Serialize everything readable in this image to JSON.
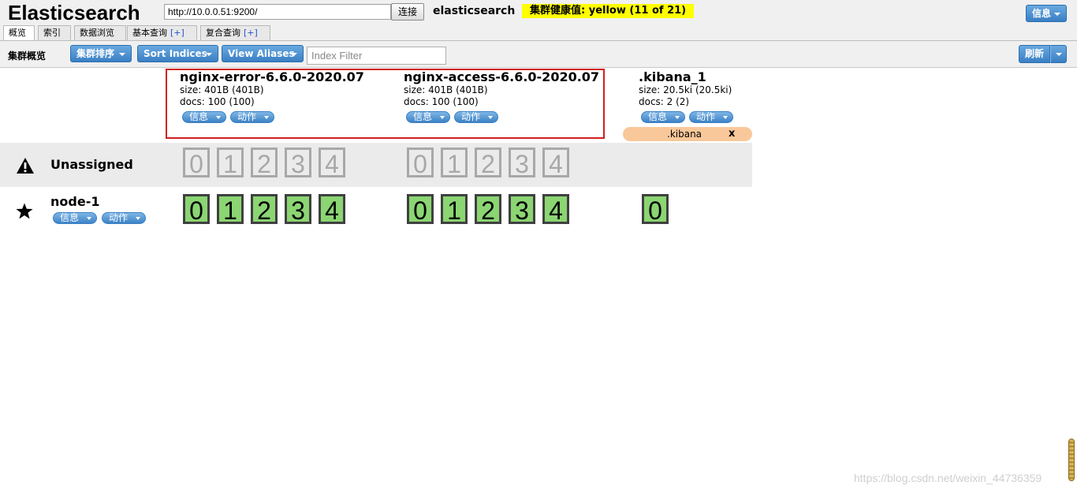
{
  "app": {
    "title": "Elasticsearch"
  },
  "connection": {
    "url": "http://10.0.0.51:9200/",
    "connect_label": "连接"
  },
  "cluster": {
    "name": "elasticsearch",
    "health": "集群健康值: yellow (11 of 21)",
    "health_color": "#ffff00"
  },
  "header": {
    "info_label": "信息"
  },
  "tabs": [
    {
      "label": "概览",
      "active": true
    },
    {
      "label": "索引"
    },
    {
      "label": "数据浏览"
    },
    {
      "label": "基本查询",
      "plus": "[+]"
    },
    {
      "label": "复合查询",
      "plus": "[+]"
    }
  ],
  "toolbar": {
    "title": "集群概览",
    "sort_cluster_label": "集群排序",
    "sort_indices_label": "Sort Indices",
    "view_aliases_label": "View Aliases",
    "filter_placeholder": "Index Filter",
    "refresh_label": "刷新"
  },
  "indices": [
    {
      "name": "nginx-error-6.6.0-2020.07",
      "size": "size: 401B (401B)",
      "docs": "docs: 100 (100)",
      "info_label": "信息",
      "action_label": "动作"
    },
    {
      "name": "nginx-access-6.6.0-2020.07",
      "size": "size: 401B (401B)",
      "docs": "docs: 100 (100)",
      "info_label": "信息",
      "action_label": "动作"
    },
    {
      "name": ".kibana_1",
      "size": "size: 20.5ki (20.5ki)",
      "docs": "docs: 2 (2)",
      "info_label": "信息",
      "action_label": "动作"
    }
  ],
  "alias": {
    "name": ".kibana",
    "close_label": "x",
    "color": "#f9c89a"
  },
  "rows": {
    "unassigned": {
      "label": "Unassigned",
      "icon": "warning-icon"
    },
    "node": {
      "label": "node-1",
      "icon": "star-icon",
      "info_label": "信息",
      "action_label": "动作"
    }
  },
  "shards": {
    "unassigned": {
      "error": [
        "0",
        "1",
        "2",
        "3",
        "4"
      ],
      "access": [
        "0",
        "1",
        "2",
        "3",
        "4"
      ]
    },
    "node": {
      "error": [
        "0",
        "1",
        "2",
        "3",
        "4"
      ],
      "access": [
        "0",
        "1",
        "2",
        "3",
        "4"
      ],
      "kibana": [
        "0"
      ]
    }
  },
  "colors": {
    "primary_button": "#3a7fc4",
    "started_shard": "#8bd572",
    "unassigned_shard": "#a8a8a8",
    "highlight_box": "#d02020"
  },
  "watermark": "https://blog.csdn.net/weixin_44736359"
}
